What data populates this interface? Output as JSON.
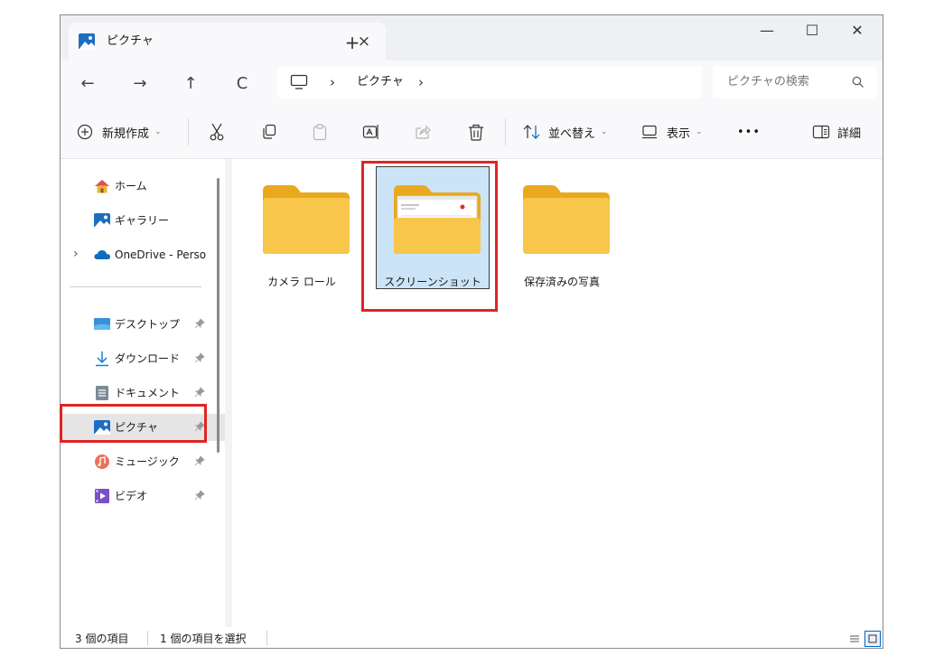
{
  "tab": {
    "title": "ピクチャ",
    "close": "×",
    "new_tab": "+"
  },
  "window_controls": {
    "minimize": "—",
    "maximize": "☐",
    "close": "✕"
  },
  "nav": {
    "back": "←",
    "forward": "→",
    "up": "↑",
    "refresh": "C"
  },
  "address": {
    "separator": "›",
    "crumbs": [
      "ピクチャ"
    ]
  },
  "search": {
    "placeholder": "ピクチャの検索"
  },
  "toolbar": {
    "new_label": "新規作成",
    "sort_label": "並べ替え",
    "view_label": "表示",
    "more_label": "•••",
    "details_label": "詳細",
    "chevron": "⌄"
  },
  "sidebar": {
    "items": [
      {
        "label": "ホーム",
        "icon": "home-icon"
      },
      {
        "label": "ギャラリー",
        "icon": "gallery-icon"
      },
      {
        "label": "OneDrive - Perso",
        "icon": "onedrive-icon",
        "expand": "›"
      },
      {
        "label": "デスクトップ",
        "icon": "desktop-icon",
        "pinned": true
      },
      {
        "label": "ダウンロード",
        "icon": "download-icon",
        "pinned": true
      },
      {
        "label": "ドキュメント",
        "icon": "document-icon",
        "pinned": true
      },
      {
        "label": "ピクチャ",
        "icon": "pictures-icon",
        "pinned": true,
        "selected": true
      },
      {
        "label": "ミュージック",
        "icon": "music-icon",
        "pinned": true
      },
      {
        "label": "ビデオ",
        "icon": "video-icon",
        "pinned": true
      }
    ]
  },
  "folders": [
    {
      "name": "カメラ ロール",
      "selected": false
    },
    {
      "name": "スクリーンショット",
      "selected": true
    },
    {
      "name": "保存済みの写真",
      "selected": false
    }
  ],
  "status": {
    "count": "3 個の項目",
    "selected": "1 個の項目を選択"
  },
  "colors": {
    "accent": "#0067c0",
    "selection": "#cce4f7",
    "highlight_box": "#e02424",
    "folder": "#f8c64a"
  }
}
